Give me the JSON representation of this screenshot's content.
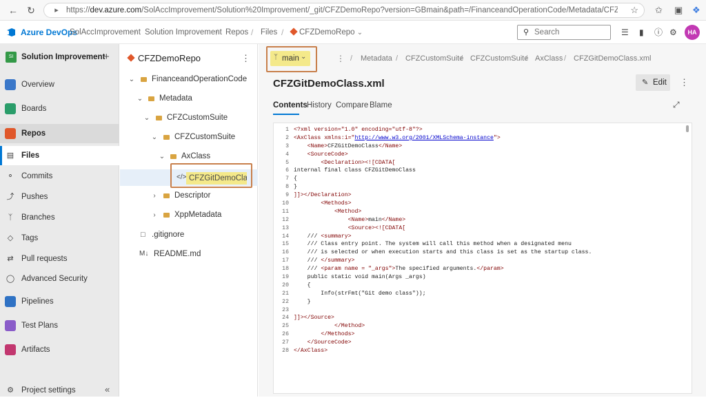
{
  "browser": {
    "url_prefix": "https://",
    "url_host": "dev.azure.com",
    "url_path": "/SolAccImprovement/Solution%20Improvement/_git/CFZDemoRepo?version=GBmain&path=/FinanceandOperationCode/Metadata/CFZCustomSuite/CFZCustomSuite/Ax..."
  },
  "header": {
    "brand": "Azure DevOps",
    "breadcrumbs": [
      "SolAccImprovement",
      "Solution Improvement",
      "Repos",
      "Files",
      "CFZDemoRepo"
    ],
    "search_placeholder": "Search",
    "avatar_initials": "HA",
    "accent_color": "#0078d4"
  },
  "sidebar": {
    "project_badge": "SI",
    "project_name": "Solution Improvement",
    "items": [
      {
        "label": "Overview",
        "icon": "overview-icon"
      },
      {
        "label": "Boards",
        "icon": "boards-icon"
      },
      {
        "label": "Repos",
        "icon": "repos-icon"
      },
      {
        "label": "Files",
        "icon": "files-icon"
      },
      {
        "label": "Commits",
        "icon": "commits-icon"
      },
      {
        "label": "Pushes",
        "icon": "pushes-icon"
      },
      {
        "label": "Branches",
        "icon": "branches-icon"
      },
      {
        "label": "Tags",
        "icon": "tags-icon"
      },
      {
        "label": "Pull requests",
        "icon": "pull-requests-icon"
      },
      {
        "label": "Advanced Security",
        "icon": "shield-icon"
      },
      {
        "label": "Pipelines",
        "icon": "pipelines-icon"
      },
      {
        "label": "Test Plans",
        "icon": "test-plans-icon"
      },
      {
        "label": "Artifacts",
        "icon": "artifacts-icon"
      }
    ],
    "settings_label": "Project settings"
  },
  "tree": {
    "repo_name": "CFZDemoRepo",
    "nodes": [
      {
        "label": "FinanceandOperationCode"
      },
      {
        "label": "Metadata"
      },
      {
        "label": "CFZCustomSuite"
      },
      {
        "label": "CFZCustomSuite"
      },
      {
        "label": "AxClass"
      },
      {
        "label": "CFZGitDemoClas"
      },
      {
        "label": "Descriptor"
      },
      {
        "label": "XppMetadata"
      },
      {
        "label": ".gitignore"
      },
      {
        "label": "README.md"
      }
    ]
  },
  "main": {
    "branch": "main",
    "path": [
      "Metadata",
      "CFZCustomSuite",
      "CFZCustomSuite",
      "AxClass",
      "CFZGitDemoClass.xml"
    ],
    "file_title": "CFZGitDemoClass.xml",
    "edit_label": "Edit",
    "tabs": [
      "Contents",
      "History",
      "Compare",
      "Blame"
    ]
  },
  "code": [
    {
      "n": "1",
      "text": "<?xml version=\"1.0\" encoding=\"utf-8\"?>"
    },
    {
      "n": "2",
      "text": "<AxClass xmlns:i=\"http://www.w3.org/2001/XMLSchema-instance\">"
    },
    {
      "n": "3",
      "text": "    <Name>CFZGitDemoClass</Name>"
    },
    {
      "n": "4",
      "text": "    <SourceCode>"
    },
    {
      "n": "5",
      "text": "        <Declaration><![CDATA["
    },
    {
      "n": "6",
      "text": "internal final class CFZGitDemoClass"
    },
    {
      "n": "7",
      "text": "{"
    },
    {
      "n": "8",
      "text": "}"
    },
    {
      "n": "9",
      "text": "]]></Declaration>"
    },
    {
      "n": "10",
      "text": "        <Methods>"
    },
    {
      "n": "11",
      "text": "            <Method>"
    },
    {
      "n": "12",
      "text": "                <Name>main</Name>"
    },
    {
      "n": "13",
      "text": "                <Source><![CDATA["
    },
    {
      "n": "14",
      "text": "    /// <summary>"
    },
    {
      "n": "15",
      "text": "    /// Class entry point. The system will call this method when a designated menu"
    },
    {
      "n": "16",
      "text": "    /// is selected or when execution starts and this class is set as the startup class."
    },
    {
      "n": "17",
      "text": "    /// </summary>"
    },
    {
      "n": "18",
      "text": "    /// <param name = \"_args\">The specified arguments.</param>"
    },
    {
      "n": "19",
      "text": "    public static void main(Args _args)"
    },
    {
      "n": "20",
      "text": "    {"
    },
    {
      "n": "21",
      "text": "        Info(strFmt(\"Git demo class\"));"
    },
    {
      "n": "22",
      "text": "    }"
    },
    {
      "n": "23",
      "text": ""
    },
    {
      "n": "24",
      "text": "]]></Source>"
    },
    {
      "n": "25",
      "text": "            </Method>"
    },
    {
      "n": "26",
      "text": "        </Methods>"
    },
    {
      "n": "27",
      "text": "    </SourceCode>"
    },
    {
      "n": "28",
      "text": "</AxClass>"
    }
  ]
}
